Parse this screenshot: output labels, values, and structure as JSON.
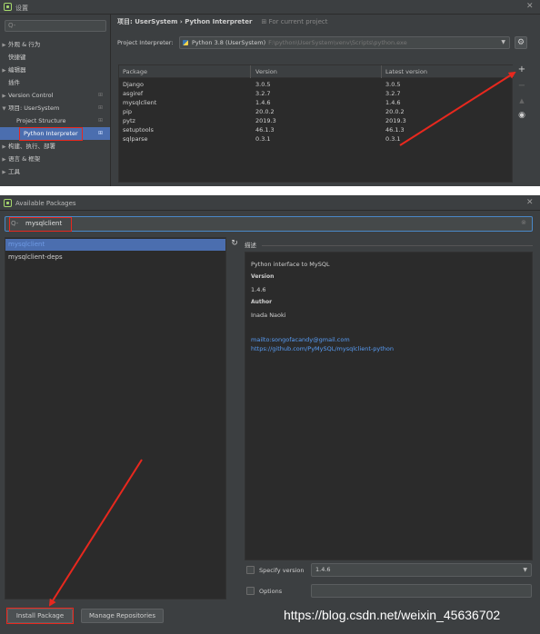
{
  "settings_window": {
    "title": "设置",
    "sidebar": {
      "search_placeholder": "Q-",
      "items": [
        {
          "arrow": "▶",
          "label": "外观 & 行为"
        },
        {
          "arrow": "",
          "label": "快捷键"
        },
        {
          "arrow": "▶",
          "label": "编辑器"
        },
        {
          "arrow": "",
          "label": "插件"
        },
        {
          "arrow": "▶",
          "label": "Version Control"
        },
        {
          "arrow": "▼",
          "label": "项目: UserSystem"
        },
        {
          "arrow": "",
          "label": "Project Structure"
        },
        {
          "arrow": "",
          "label": "Python Interpreter"
        },
        {
          "arrow": "▶",
          "label": "构建、执行、部署"
        },
        {
          "arrow": "▶",
          "label": "语言 & 框架"
        },
        {
          "arrow": "▶",
          "label": "工具"
        }
      ]
    },
    "breadcrumb": {
      "path": "项目: UserSystem › Python Interpreter",
      "note": "⊞ For current project"
    },
    "interpreter": {
      "label": "Project Interpreter:",
      "value": "Python 3.8 (UserSystem)",
      "path": "F:\\python\\UserSystem\\venv\\Scripts\\python.exe"
    },
    "table": {
      "headers": [
        "Package",
        "Version",
        "Latest version"
      ],
      "rows": [
        [
          "Django",
          "3.0.5",
          "3.0.5"
        ],
        [
          "asgiref",
          "3.2.7",
          "3.2.7"
        ],
        [
          "mysqlclient",
          "1.4.6",
          "1.4.6"
        ],
        [
          "pip",
          "20.0.2",
          "20.0.2"
        ],
        [
          "pytz",
          "2019.3",
          "2019.3"
        ],
        [
          "setuptools",
          "46.1.3",
          "46.1.3"
        ],
        [
          "sqlparse",
          "0.3.1",
          "0.3.1"
        ]
      ]
    },
    "tools": {
      "add": "+",
      "remove": "−",
      "up": "▲",
      "show": "◉"
    }
  },
  "available_packages": {
    "title": "Available Packages",
    "search_value": "mysqlclient",
    "list": [
      "mysqlclient",
      "mysqlclient-deps"
    ],
    "description_label": "描述",
    "description": {
      "summary": "Python interface to MySQL",
      "version_label": "Version",
      "version": "1.4.6",
      "author_label": "Author",
      "author": "Inada Naoki",
      "email": "mailto:songofacandy@gmail.com",
      "url": "https://github.com/PyMySQL/mysqlclient-python"
    },
    "specify_version_label": "Specify version",
    "specify_version_value": "1.4.6",
    "options_label": "Options",
    "install_button": "Install Package",
    "manage_button": "Manage Repositories"
  },
  "watermark": "https://blog.csdn.net/weixin_45636702",
  "colors": {
    "annotation_red": "#e8281e",
    "selection": "#4b6eaf",
    "link": "#589df6"
  }
}
